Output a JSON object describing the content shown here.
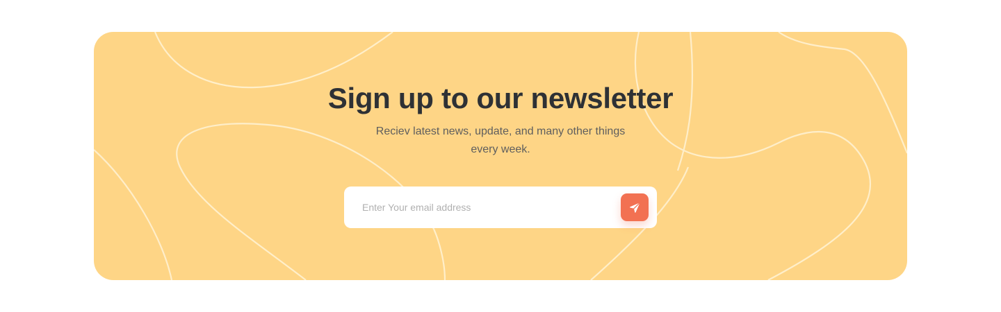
{
  "newsletter": {
    "title": "Sign up to our newsletter",
    "subtitle": "Reciev latest news, update, and many other things every week.",
    "email_placeholder": "Enter Your email address",
    "submit_icon": "paper-plane-icon"
  },
  "colors": {
    "card_background": "#fed586",
    "accent": "#f27152",
    "title": "#2e3135",
    "subtitle": "#5e5e5e"
  }
}
